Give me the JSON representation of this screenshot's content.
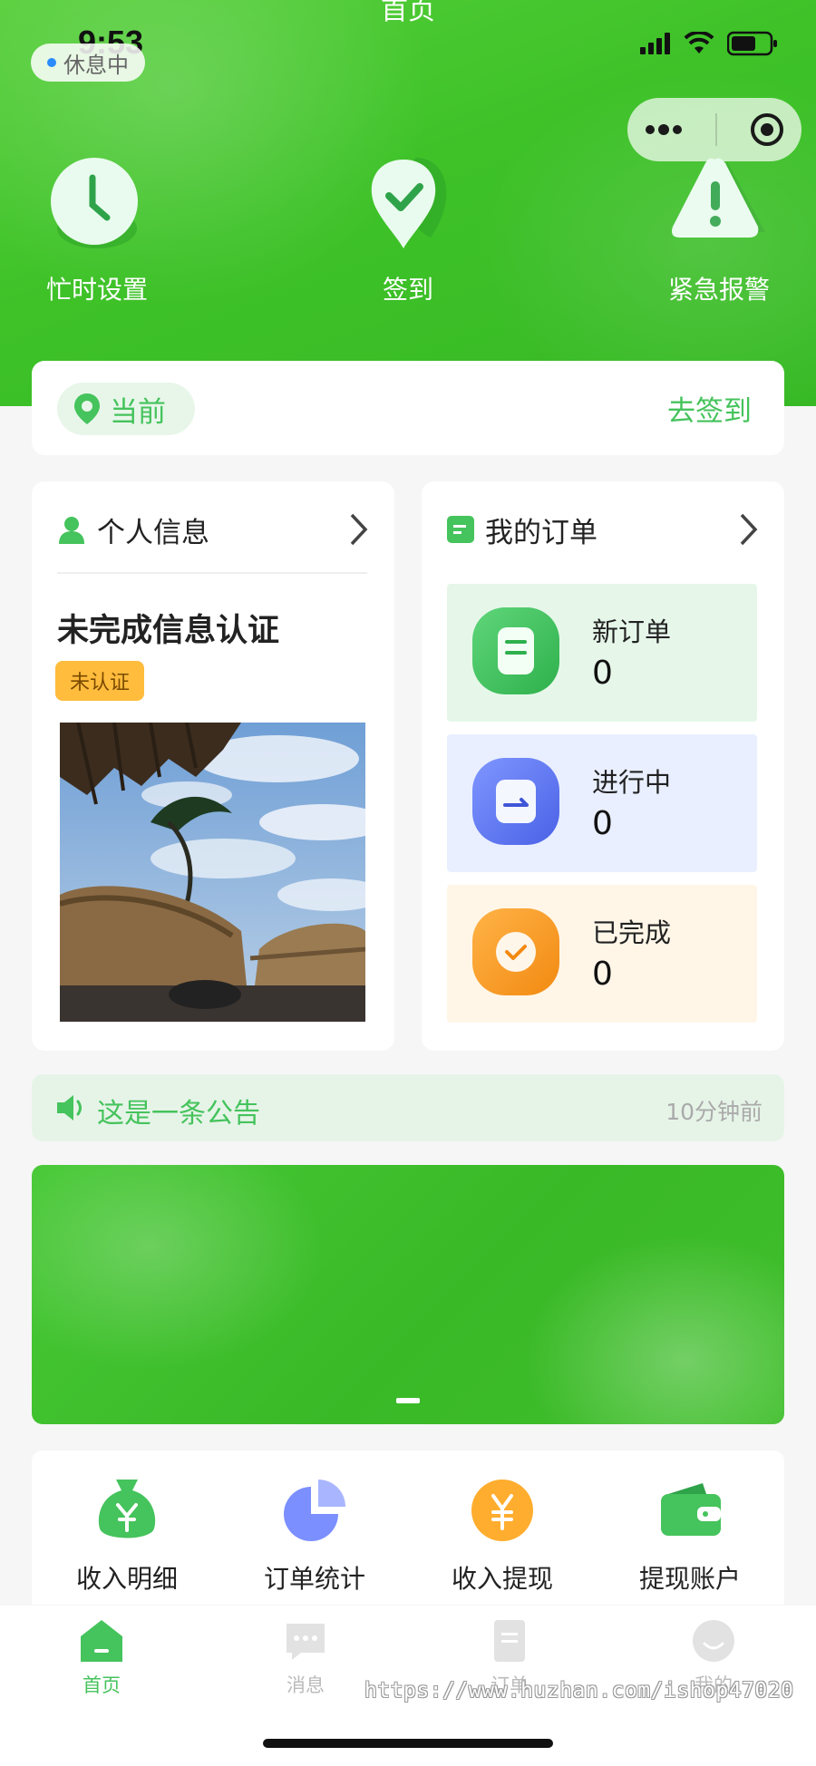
{
  "header": {
    "page_title": "首页",
    "status_time": "9:53",
    "status_pill": "休息中"
  },
  "quick_actions": [
    {
      "label": "忙时设置",
      "icon": "clock-icon"
    },
    {
      "label": "签到",
      "icon": "check-pin-icon"
    },
    {
      "label": "紧急报警",
      "icon": "alert-triangle-icon"
    }
  ],
  "sign": {
    "location_label": "当前",
    "go_sign_label": "去签到"
  },
  "personal": {
    "title": "个人信息",
    "status_title": "未完成信息认证",
    "badge": "未认证"
  },
  "orders": {
    "title": "我的订单",
    "items": [
      {
        "label": "新订单",
        "count": "0",
        "bg": "#e6f7ea",
        "icon": "document-icon"
      },
      {
        "label": "进行中",
        "count": "0",
        "bg": "#e9efff",
        "icon": "arrow-card-icon"
      },
      {
        "label": "已完成",
        "count": "0",
        "bg": "#fff6e8",
        "icon": "check-circle-icon"
      }
    ]
  },
  "notice": {
    "text": "这是一条公告",
    "time": "10分钟前"
  },
  "tools": [
    {
      "label": "收入明细",
      "icon": "money-bag-icon"
    },
    {
      "label": "订单统计",
      "icon": "pie-chart-icon"
    },
    {
      "label": "收入提现",
      "icon": "yen-coin-icon"
    },
    {
      "label": "提现账户",
      "icon": "wallet-icon"
    }
  ],
  "tabbar": [
    {
      "label": "首页",
      "active": true
    },
    {
      "label": "消息",
      "active": false
    },
    {
      "label": "订单",
      "active": false
    },
    {
      "label": "我的",
      "active": false
    }
  ],
  "watermark": "https://www.huzhan.com/ishop47020",
  "colors": {
    "brand_green": "#3ec228",
    "accent_green": "#45c35c",
    "badge_orange": "#ffbc3d"
  }
}
